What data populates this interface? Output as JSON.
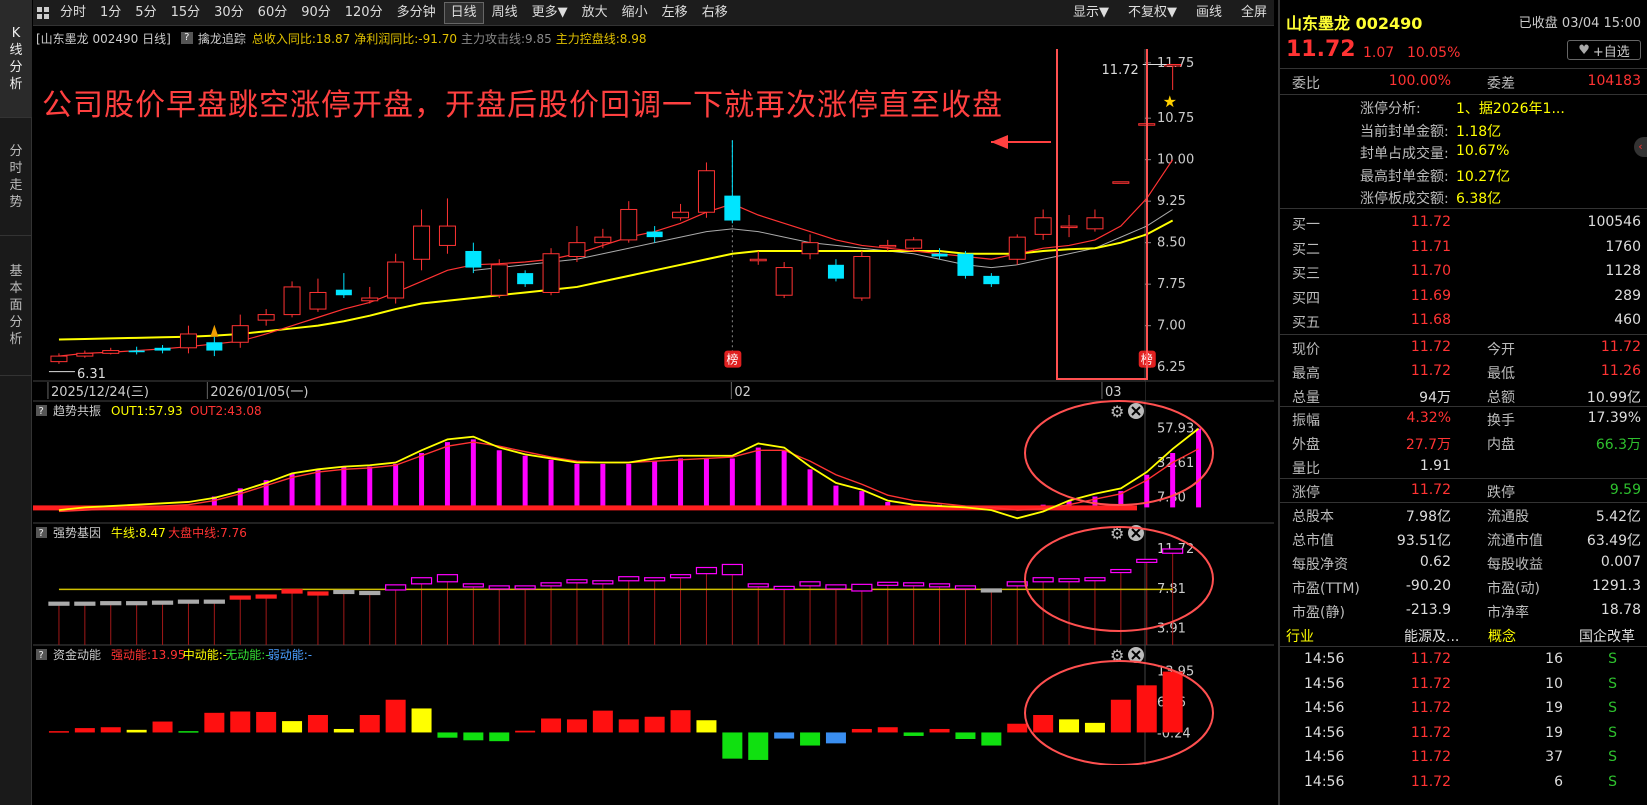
{
  "left_tabs": [
    "K线分析",
    "分时走势",
    "基本面分析"
  ],
  "toolbar": {
    "left": [
      "分时",
      "1分",
      "5分",
      "15分",
      "30分",
      "60分",
      "90分",
      "120分",
      "多分钟",
      "日线",
      "周线",
      "更多▼",
      "放大",
      "缩小",
      "左移",
      "右移"
    ],
    "active": "日线",
    "right": [
      "显示▼",
      "不复权▼",
      "画线",
      "全屏"
    ]
  },
  "infobar": {
    "stock": "[山东墨龙 002490 日线]",
    "indicator": "擒龙追踪",
    "fields": [
      {
        "text": "总收入同比:18.87",
        "color": "#e0c000"
      },
      {
        "text": "净利润同比:-91.70",
        "color": "#e0c000"
      },
      {
        "text": "主力攻击线:9.85",
        "color": "#888888"
      },
      {
        "text": "主力控盘线:8.98",
        "color": "#e0c000"
      }
    ]
  },
  "annotation": "公司股价早盘跳空涨停开盘，开盘后股价回调一下就再次涨停直至收盘",
  "main_chart": {
    "y_ticks": [
      "11.75",
      "10.75",
      "10.00",
      "9.25",
      "8.50",
      "7.75",
      "7.00",
      "6.25"
    ],
    "dates": [
      "2025/12/24(三)",
      "2026/01/05(一)",
      "02",
      "03"
    ],
    "price_high_label": "11.72",
    "price_low_label": "6.31",
    "badge": "榜",
    "candles": [
      {
        "o": 6.35,
        "c": 6.45,
        "h": 6.5,
        "l": 6.31
      },
      {
        "o": 6.45,
        "c": 6.5,
        "h": 6.55,
        "l": 6.42
      },
      {
        "o": 6.5,
        "c": 6.55,
        "h": 6.6,
        "l": 6.48
      },
      {
        "o": 6.55,
        "c": 6.52,
        "h": 6.62,
        "l": 6.48
      },
      {
        "o": 6.6,
        "c": 6.55,
        "h": 6.65,
        "l": 6.5
      },
      {
        "o": 6.6,
        "c": 6.85,
        "h": 7.0,
        "l": 6.5
      },
      {
        "o": 6.7,
        "c": 6.55,
        "h": 6.8,
        "l": 6.45
      },
      {
        "o": 6.7,
        "c": 7.0,
        "h": 7.2,
        "l": 6.6
      },
      {
        "o": 7.1,
        "c": 7.2,
        "h": 7.3,
        "l": 7.0
      },
      {
        "o": 7.2,
        "c": 7.7,
        "h": 7.8,
        "l": 7.15
      },
      {
        "o": 7.3,
        "c": 7.6,
        "h": 7.85,
        "l": 7.25
      },
      {
        "o": 7.65,
        "c": 7.55,
        "h": 7.95,
        "l": 7.5
      },
      {
        "o": 7.45,
        "c": 7.5,
        "h": 7.7,
        "l": 7.4
      },
      {
        "o": 7.5,
        "c": 8.15,
        "h": 8.3,
        "l": 7.4
      },
      {
        "o": 8.2,
        "c": 8.8,
        "h": 9.1,
        "l": 8.0
      },
      {
        "o": 8.45,
        "c": 8.8,
        "h": 9.3,
        "l": 8.3
      },
      {
        "o": 8.35,
        "c": 8.05,
        "h": 8.5,
        "l": 7.95
      },
      {
        "o": 7.55,
        "c": 8.1,
        "h": 8.2,
        "l": 7.5
      },
      {
        "o": 7.95,
        "c": 7.75,
        "h": 8.0,
        "l": 7.7
      },
      {
        "o": 7.6,
        "c": 8.3,
        "h": 8.4,
        "l": 7.55
      },
      {
        "o": 8.25,
        "c": 8.5,
        "h": 8.8,
        "l": 8.15
      },
      {
        "o": 8.5,
        "c": 8.6,
        "h": 8.75,
        "l": 8.4
      },
      {
        "o": 8.55,
        "c": 9.1,
        "h": 9.25,
        "l": 8.5
      },
      {
        "o": 8.7,
        "c": 8.6,
        "h": 8.8,
        "l": 8.5
      },
      {
        "o": 8.95,
        "c": 9.05,
        "h": 9.2,
        "l": 8.9
      },
      {
        "o": 9.05,
        "c": 9.8,
        "h": 9.95,
        "l": 8.95
      },
      {
        "o": 9.35,
        "c": 8.9,
        "h": 10.35,
        "l": 8.85
      },
      {
        "o": 8.2,
        "c": 8.2,
        "h": 8.35,
        "l": 8.1
      },
      {
        "o": 7.55,
        "c": 8.05,
        "h": 8.15,
        "l": 7.5
      },
      {
        "o": 8.3,
        "c": 8.5,
        "h": 8.65,
        "l": 8.2
      },
      {
        "o": 8.1,
        "c": 7.85,
        "h": 8.2,
        "l": 7.8
      },
      {
        "o": 7.5,
        "c": 8.25,
        "h": 8.35,
        "l": 7.45
      },
      {
        "o": 8.45,
        "c": 8.45,
        "h": 8.55,
        "l": 8.35
      },
      {
        "o": 8.4,
        "c": 8.55,
        "h": 8.6,
        "l": 8.35
      },
      {
        "o": 8.3,
        "c": 8.25,
        "h": 8.4,
        "l": 8.2
      },
      {
        "o": 8.3,
        "c": 7.9,
        "h": 8.35,
        "l": 7.85
      },
      {
        "o": 7.9,
        "c": 7.75,
        "h": 7.95,
        "l": 7.7
      },
      {
        "o": 8.2,
        "c": 8.6,
        "h": 8.65,
        "l": 8.1
      },
      {
        "o": 8.65,
        "c": 8.95,
        "h": 9.1,
        "l": 8.55
      },
      {
        "o": 8.8,
        "c": 8.8,
        "h": 9.0,
        "l": 8.6
      },
      {
        "o": 8.75,
        "c": 8.95,
        "h": 9.1,
        "l": 8.7
      },
      {
        "o": 9.6,
        "c": 9.6,
        "h": 9.6,
        "l": 9.6
      },
      {
        "o": 10.65,
        "c": 10.65,
        "h": 10.65,
        "l": 10.65
      },
      {
        "o": 11.72,
        "c": 11.72,
        "h": 11.72,
        "l": 11.26
      }
    ],
    "ma_red": [
      6.45,
      6.5,
      6.52,
      6.55,
      6.58,
      6.62,
      6.67,
      6.72,
      6.85,
      7.0,
      7.15,
      7.3,
      7.42,
      7.6,
      7.8,
      8.0,
      8.1,
      8.12,
      8.15,
      8.2,
      8.3,
      8.45,
      8.6,
      8.7,
      8.85,
      9.05,
      9.2,
      9.0,
      8.85,
      8.7,
      8.55,
      8.45,
      8.4,
      8.35,
      8.3,
      8.25,
      8.2,
      8.3,
      8.4,
      8.45,
      8.55,
      8.8,
      9.3,
      10.0
    ],
    "ma_white": [
      null,
      null,
      null,
      null,
      null,
      null,
      null,
      null,
      null,
      null,
      null,
      null,
      null,
      null,
      null,
      null,
      8.0,
      8.05,
      8.1,
      8.15,
      8.2,
      8.3,
      8.4,
      8.5,
      8.6,
      8.7,
      8.75,
      8.7,
      8.6,
      8.5,
      8.45,
      8.4,
      8.35,
      8.3,
      8.2,
      8.1,
      8.05,
      8.1,
      8.2,
      8.3,
      8.4,
      8.6,
      8.8,
      9.1
    ],
    "ma_yellow": [
      6.75,
      6.76,
      6.77,
      6.78,
      6.79,
      6.8,
      6.82,
      6.85,
      6.9,
      6.95,
      7.0,
      7.08,
      7.18,
      7.3,
      7.4,
      7.45,
      7.5,
      7.55,
      7.6,
      7.65,
      7.7,
      7.8,
      7.9,
      8.0,
      8.1,
      8.2,
      8.3,
      8.35,
      8.35,
      8.35,
      8.35,
      8.35,
      8.35,
      8.35,
      8.35,
      8.3,
      8.3,
      8.3,
      8.35,
      8.38,
      8.4,
      8.5,
      8.65,
      8.9
    ]
  },
  "sub1": {
    "title": "趋势共振",
    "fields": [
      {
        "text": "OUT1:57.93",
        "color": "#ffff00"
      },
      {
        "text": "OUT2:43.08",
        "color": "#ff3333"
      }
    ],
    "y_ticks": [
      "57.93",
      "32.61",
      "7.30"
    ],
    "bars": [
      0,
      0,
      0,
      0,
      0,
      0,
      8,
      14,
      20,
      25,
      28,
      30,
      30,
      32,
      40,
      48,
      50,
      42,
      38,
      35,
      32,
      32,
      32,
      34,
      36,
      36,
      36,
      44,
      42,
      28,
      16,
      12,
      4,
      2,
      2,
      1,
      1,
      1,
      2,
      5,
      8,
      12,
      24,
      40,
      57.93
    ],
    "yellow": [
      -2,
      0,
      1,
      2,
      3,
      4,
      7,
      12,
      18,
      25,
      28,
      30,
      31,
      33,
      42,
      50,
      52,
      44,
      39,
      36,
      33,
      33,
      33,
      36,
      38,
      38,
      38,
      47,
      44,
      30,
      18,
      13,
      5,
      2,
      1,
      0,
      -2,
      -8,
      -3,
      5,
      10,
      14,
      26,
      43,
      57.93
    ],
    "red": [
      -3,
      -2,
      -1,
      0,
      1,
      2,
      5,
      10,
      16,
      22,
      26,
      28,
      29,
      31,
      38,
      45,
      48,
      45,
      41,
      37,
      34,
      33,
      33,
      34,
      35,
      36,
      37,
      42,
      42,
      34,
      24,
      17,
      9,
      5,
      3,
      1,
      0,
      -2,
      -1,
      2,
      6,
      10,
      20,
      33,
      43.08
    ]
  },
  "sub2": {
    "title": "强势基因",
    "fields": [
      {
        "text": "牛线:8.47",
        "color": "#ffff00"
      },
      {
        "text": "大盘中线:7.76",
        "color": "#ff3333"
      }
    ],
    "y_ticks": [
      "11.72",
      "7.81",
      "3.91"
    ],
    "boxes": [
      {
        "o": 6.4,
        "c": 6.5,
        "col": "grey"
      },
      {
        "o": 6.45,
        "c": 6.5,
        "col": "grey"
      },
      {
        "o": 6.5,
        "c": 6.55,
        "col": "grey"
      },
      {
        "o": 6.5,
        "c": 6.55,
        "col": "grey"
      },
      {
        "o": 6.55,
        "c": 6.6,
        "col": "grey"
      },
      {
        "o": 6.6,
        "c": 6.7,
        "col": "grey"
      },
      {
        "o": 6.6,
        "c": 6.7,
        "col": "grey"
      },
      {
        "o": 7.0,
        "c": 7.1,
        "col": "red"
      },
      {
        "o": 7.1,
        "c": 7.2,
        "col": "red"
      },
      {
        "o": 7.4,
        "c": 7.75,
        "col": "red"
      },
      {
        "o": 7.4,
        "c": 7.5,
        "col": "red"
      },
      {
        "o": 7.6,
        "c": 7.65,
        "col": "grey"
      },
      {
        "o": 7.5,
        "c": 7.55,
        "col": "grey"
      },
      {
        "o": 7.7,
        "c": 8.2,
        "col": "mag"
      },
      {
        "o": 8.3,
        "c": 8.9,
        "col": "mag"
      },
      {
        "o": 8.5,
        "c": 9.2,
        "col": "mag"
      },
      {
        "o": 8.0,
        "c": 8.3,
        "col": "mag"
      },
      {
        "o": 7.8,
        "c": 8.1,
        "col": "mag"
      },
      {
        "o": 7.9,
        "c": 8.1,
        "col": "mag"
      },
      {
        "o": 8.1,
        "c": 8.4,
        "col": "mag"
      },
      {
        "o": 8.4,
        "c": 8.7,
        "col": "mag"
      },
      {
        "o": 8.3,
        "c": 8.6,
        "col": "mag"
      },
      {
        "o": 8.6,
        "c": 9.0,
        "col": "mag"
      },
      {
        "o": 8.6,
        "c": 8.9,
        "col": "mag"
      },
      {
        "o": 8.9,
        "c": 9.2,
        "col": "mag"
      },
      {
        "o": 9.3,
        "c": 9.9,
        "col": "mag"
      },
      {
        "o": 9.2,
        "c": 10.2,
        "col": "mag"
      },
      {
        "o": 8.1,
        "c": 8.3,
        "col": "mag"
      },
      {
        "o": 7.8,
        "c": 8.05,
        "col": "mag"
      },
      {
        "o": 8.1,
        "c": 8.5,
        "col": "mag"
      },
      {
        "o": 7.8,
        "c": 8.2,
        "col": "mag"
      },
      {
        "o": 7.6,
        "c": 8.25,
        "col": "mag"
      },
      {
        "o": 8.3,
        "c": 8.45,
        "col": "mag"
      },
      {
        "o": 8.2,
        "c": 8.4,
        "col": "mag"
      },
      {
        "o": 8.1,
        "c": 8.3,
        "col": "mag"
      },
      {
        "o": 7.8,
        "c": 8.1,
        "col": "mag"
      },
      {
        "o": 7.7,
        "c": 7.8,
        "col": "grey"
      },
      {
        "o": 8.1,
        "c": 8.5,
        "col": "mag"
      },
      {
        "o": 8.5,
        "c": 8.9,
        "col": "mag"
      },
      {
        "o": 8.6,
        "c": 8.8,
        "col": "mag"
      },
      {
        "o": 8.7,
        "c": 8.9,
        "col": "mag"
      },
      {
        "o": 9.6,
        "c": 9.7,
        "col": "mag"
      },
      {
        "o": 10.6,
        "c": 10.7,
        "col": "mag"
      },
      {
        "o": 11.3,
        "c": 11.72,
        "col": "mag"
      }
    ],
    "yellow_line": 7.76
  },
  "sub3": {
    "title": "资金动能",
    "fields": [
      {
        "text": "强动能:13.95",
        "color": "#ff3333"
      },
      {
        "text": "中动能:-",
        "color": "#ffff00"
      },
      {
        "text": "无动能:-",
        "color": "#33dd33"
      },
      {
        "text": "弱动能:-",
        "color": "#4a9eff"
      }
    ],
    "y_ticks": [
      "13.95",
      "6.86",
      "-0.24"
    ],
    "bars": [
      {
        "v": 0.3,
        "col": "red"
      },
      {
        "v": 1.0,
        "col": "red"
      },
      {
        "v": 1.2,
        "col": "red"
      },
      {
        "v": 0.6,
        "col": "yellow"
      },
      {
        "v": 2.5,
        "col": "red"
      },
      {
        "v": 0.3,
        "col": "green"
      },
      {
        "v": 4.5,
        "col": "red"
      },
      {
        "v": 4.8,
        "col": "red"
      },
      {
        "v": 4.7,
        "col": "red"
      },
      {
        "v": 2.6,
        "col": "yellow"
      },
      {
        "v": 4.0,
        "col": "red"
      },
      {
        "v": 0.8,
        "col": "yellow"
      },
      {
        "v": 4.0,
        "col": "red"
      },
      {
        "v": 7.5,
        "col": "red"
      },
      {
        "v": 5.5,
        "col": "yellow"
      },
      {
        "v": -1.2,
        "col": "green"
      },
      {
        "v": -1.8,
        "col": "green"
      },
      {
        "v": -2.0,
        "col": "green"
      },
      {
        "v": 0.4,
        "col": "red"
      },
      {
        "v": 3.2,
        "col": "red"
      },
      {
        "v": 3.0,
        "col": "red"
      },
      {
        "v": 5.0,
        "col": "red"
      },
      {
        "v": 3.0,
        "col": "red"
      },
      {
        "v": 3.6,
        "col": "red"
      },
      {
        "v": 5.1,
        "col": "red"
      },
      {
        "v": 2.8,
        "col": "yellow"
      },
      {
        "v": -6.0,
        "col": "green"
      },
      {
        "v": -6.3,
        "col": "green"
      },
      {
        "v": -1.4,
        "col": "blue"
      },
      {
        "v": -3.0,
        "col": "green"
      },
      {
        "v": -2.5,
        "col": "blue"
      },
      {
        "v": 0.8,
        "col": "red"
      },
      {
        "v": 1.2,
        "col": "red"
      },
      {
        "v": -0.8,
        "col": "green"
      },
      {
        "v": 0.8,
        "col": "red"
      },
      {
        "v": -1.5,
        "col": "green"
      },
      {
        "v": -3.0,
        "col": "green"
      },
      {
        "v": 2.0,
        "col": "red"
      },
      {
        "v": 4.0,
        "col": "red"
      },
      {
        "v": 3.0,
        "col": "yellow"
      },
      {
        "v": 2.2,
        "col": "yellow"
      },
      {
        "v": 7.5,
        "col": "red"
      },
      {
        "v": 10.8,
        "col": "red"
      },
      {
        "v": 13.95,
        "col": "red"
      }
    ]
  },
  "panel": {
    "name": "山东墨龙 002490",
    "status": "已收盘 03/04 15:00",
    "price": "11.72",
    "change": "1.07",
    "pct": "10.05%",
    "watch": "+自选",
    "weibi": {
      "l1": "委比",
      "v1": "100.00%",
      "l2": "委差",
      "v2": "104183"
    },
    "limit_info": [
      {
        "k": "涨停分析:",
        "v": "1、据2026年1..."
      },
      {
        "k": "当前封单金额:",
        "v": "1.18亿"
      },
      {
        "k": "封单占成交量:",
        "v": "10.67%"
      },
      {
        "k": "最高封单金额:",
        "v": "10.27亿"
      },
      {
        "k": "涨停板成交额:",
        "v": "6.38亿"
      }
    ],
    "bids": [
      {
        "k": "买一",
        "p": "11.72",
        "v": "100546"
      },
      {
        "k": "买二",
        "p": "11.71",
        "v": "1760"
      },
      {
        "k": "买三",
        "p": "11.70",
        "v": "1128"
      },
      {
        "k": "买四",
        "p": "11.69",
        "v": "289"
      },
      {
        "k": "买五",
        "p": "11.68",
        "v": "460"
      }
    ],
    "quote": [
      {
        "k1": "现价",
        "v1": "11.72",
        "c1": "red",
        "k2": "今开",
        "v2": "11.72",
        "c2": "red"
      },
      {
        "k1": "最高",
        "v1": "11.72",
        "c1": "red",
        "k2": "最低",
        "v2": "11.26",
        "c2": "red"
      },
      {
        "k1": "总量",
        "v1": "94万",
        "c1": "white",
        "k2": "总额",
        "v2": "10.99亿",
        "c2": "white"
      }
    ],
    "quote2": [
      {
        "k1": "振幅",
        "v1": "4.32%",
        "c1": "red",
        "k2": "换手",
        "v2": "17.39%",
        "c2": "white"
      },
      {
        "k1": "外盘",
        "v1": "27.7万",
        "c1": "red",
        "k2": "内盘",
        "v2": "66.3万",
        "c2": "green"
      },
      {
        "k1": "量比",
        "v1": "1.91",
        "c1": "white",
        "k2": "",
        "v2": "",
        "c2": "white"
      }
    ],
    "limits": {
      "k1": "涨停",
      "v1": "11.72",
      "k2": "跌停",
      "v2": "9.59"
    },
    "fund": [
      {
        "k1": "总股本",
        "v1": "7.98亿",
        "k2": "流通股",
        "v2": "5.42亿"
      },
      {
        "k1": "总市值",
        "v1": "93.51亿",
        "k2": "流通市值",
        "v2": "63.49亿"
      },
      {
        "k1": "每股净资",
        "v1": "0.62",
        "k2": "每股收益",
        "v2": "0.007"
      },
      {
        "k1": "市盈(TTM)",
        "v1": "-90.20",
        "k2": "市盈(动)",
        "v2": "1291.3"
      },
      {
        "k1": "市盈(静)",
        "v1": "-213.9",
        "k2": "市净率",
        "v2": "18.78"
      }
    ],
    "industry": {
      "k1": "行业",
      "v1": "能源及...",
      "k2": "概念",
      "v2": "国企改革"
    },
    "ticks": [
      {
        "t": "14:56",
        "p": "11.72",
        "v": "16",
        "d": "S"
      },
      {
        "t": "14:56",
        "p": "11.72",
        "v": "10",
        "d": "S"
      },
      {
        "t": "14:56",
        "p": "11.72",
        "v": "19",
        "d": "S"
      },
      {
        "t": "14:56",
        "p": "11.72",
        "v": "19",
        "d": "S"
      },
      {
        "t": "14:56",
        "p": "11.72",
        "v": "37",
        "d": "S"
      },
      {
        "t": "14:56",
        "p": "11.72",
        "v": "6",
        "d": "S"
      }
    ]
  },
  "colors": {
    "up": "#ff3333",
    "down": "#00e5ff",
    "magenta": "#ff00ff",
    "yellow": "#ffff00",
    "annot": "#ff4040"
  }
}
